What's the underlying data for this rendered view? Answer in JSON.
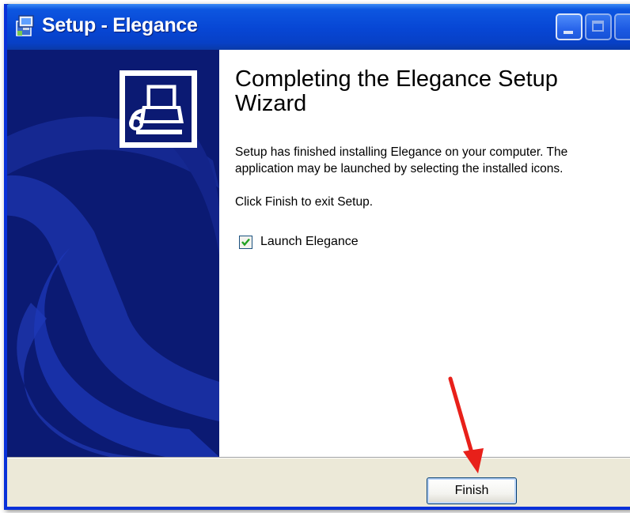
{
  "window": {
    "title": "Setup - Elegance",
    "icon": "setup-installer-icon",
    "controls": [
      "minimize-icon",
      "maximize-icon",
      "close-icon"
    ]
  },
  "sidebar": {
    "logo_icon": "computer-install-icon"
  },
  "content": {
    "heading": "Completing the Elegance Setup Wizard",
    "description": "Setup has finished installing Elegance on your computer. The application may be launched by selecting the installed icons.",
    "finish_instruction": "Click Finish to exit Setup.",
    "launch_option": {
      "label": "Launch Elegance",
      "checked": true
    }
  },
  "footer": {
    "finish_label": "Finish"
  },
  "annotation": {
    "icon": "red-arrow-icon",
    "color": "#e8201a"
  },
  "colors": {
    "titlebar": "#0746d4",
    "sidebar": "#0b1a73",
    "footer": "#ece9d8"
  }
}
